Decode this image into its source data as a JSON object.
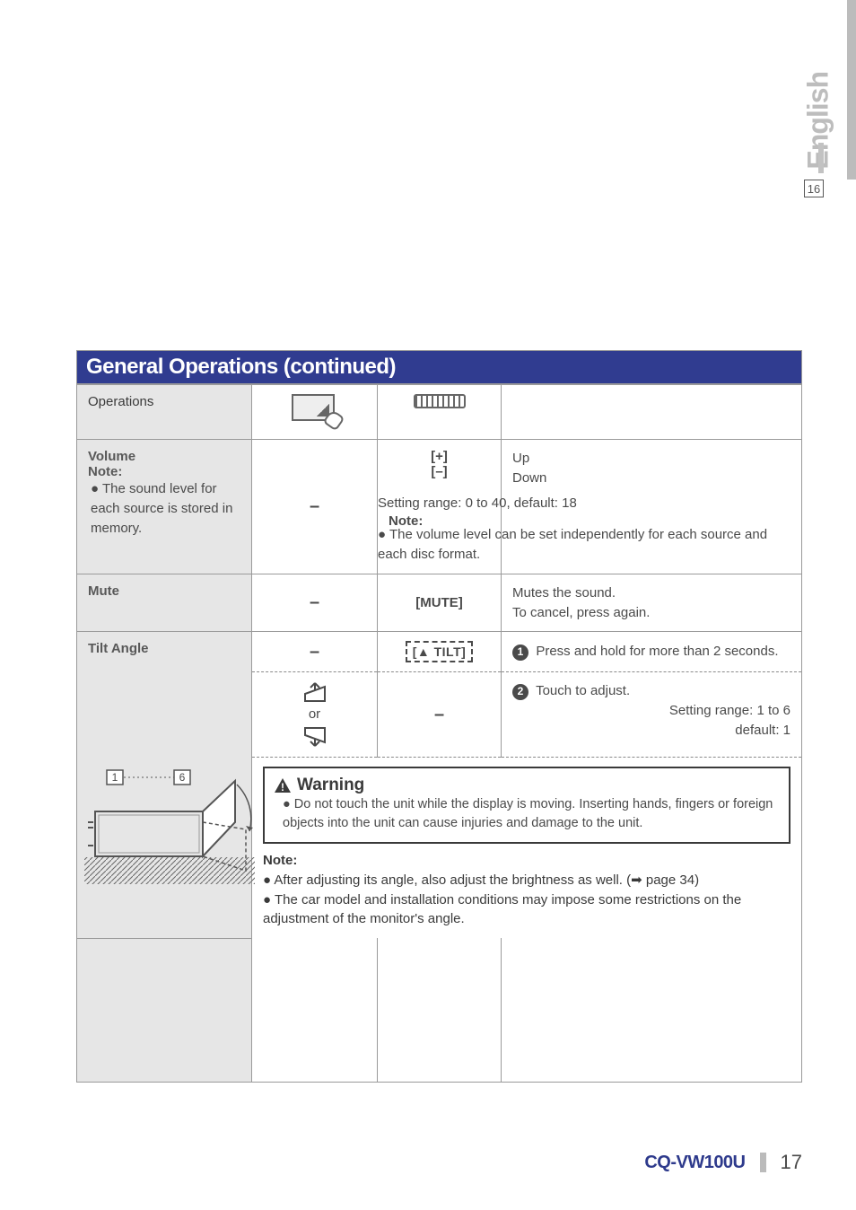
{
  "lang_tab": "English",
  "ref_page_box": "16",
  "section_title": "General Operations (continued)",
  "hdr": {
    "operations": "Operations"
  },
  "rows": {
    "volume": {
      "title": "Volume",
      "note_lead": "Note:",
      "note_body": "The sound level for each source is stored in memory.",
      "btn_plus": "[+]",
      "btn_minus": "[–]",
      "up": "Up",
      "down": "Down",
      "range": "Setting range: 0 to 40,  default: 18",
      "note2_lead": "Note:",
      "note2_body": "The volume level can be set independently for each source and each disc format."
    },
    "mute": {
      "title": "Mute",
      "btn": "[MUTE]",
      "desc1": "Mutes the sound.",
      "desc2": "To cancel, press again."
    },
    "tilt": {
      "title": "Tilt Angle",
      "btn": "[▲ TILT]",
      "step1": "Press and hold for more than 2 seconds.",
      "or": "or",
      "step2": "Touch to adjust.",
      "range": "Setting range: 1 to 6",
      "default": "default: 1",
      "diagram_labels": {
        "a": "1",
        "b": "6"
      }
    },
    "warning": {
      "title": "Warning",
      "text": "Do not touch the unit while the display is moving. Inserting hands, fingers or foreign objects into the unit can cause injuries and damage to the unit.",
      "note_lead": "Note:",
      "note_line1": "After adjusting its angle, also adjust the brightness as well. (➡ page 34)",
      "note_line2": "The car model and installation conditions may impose some restrictions on the adjustment of the monitor's angle."
    }
  },
  "footer": {
    "model": "CQ-VW100U",
    "page": "17"
  }
}
